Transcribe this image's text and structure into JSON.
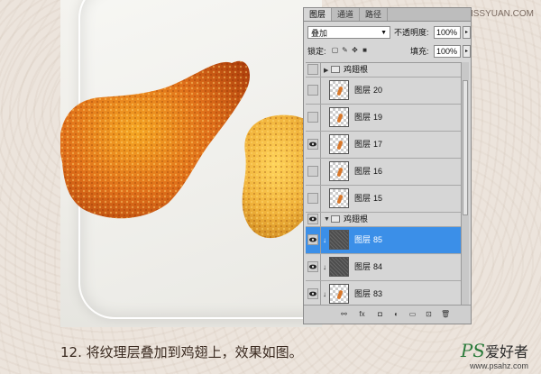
{
  "watermark_top": "思缘设计论坛 www.MISSYUAN.COM",
  "panel": {
    "tabs": [
      "图层",
      "通道",
      "路径"
    ],
    "blend_mode": "叠加",
    "opacity_label": "不透明度:",
    "opacity_value": "100%",
    "lock_label": "锁定:",
    "fill_label": "填充:",
    "fill_value": "100%",
    "layers": [
      {
        "name": "鸡翅根",
        "type": "group",
        "expanded": false,
        "visible": false
      },
      {
        "name": "图层",
        "num": "20",
        "visible": false
      },
      {
        "name": "图层",
        "num": "19",
        "visible": false
      },
      {
        "name": "图层",
        "num": "17",
        "visible": true
      },
      {
        "name": "图层",
        "num": "16",
        "visible": false
      },
      {
        "name": "图层",
        "num": "15",
        "visible": false
      },
      {
        "name": "鸡翅根",
        "type": "group",
        "expanded": true,
        "visible": true
      },
      {
        "name": "图层",
        "num": "85",
        "visible": true,
        "selected": true,
        "clipped": true,
        "dark": true
      },
      {
        "name": "图层",
        "num": "84",
        "visible": true,
        "clipped": true,
        "dark": true
      },
      {
        "name": "图层",
        "num": "83",
        "visible": true,
        "clipped": true
      }
    ]
  },
  "caption": "12. 将纹理层叠加到鸡翅上，效果如图。",
  "logo": {
    "ps": "PS",
    "han": "爱好者",
    "url": "www.psahz.com"
  },
  "colors": {
    "selected": "#3b8fe8",
    "panel": "#d6d6d6"
  }
}
